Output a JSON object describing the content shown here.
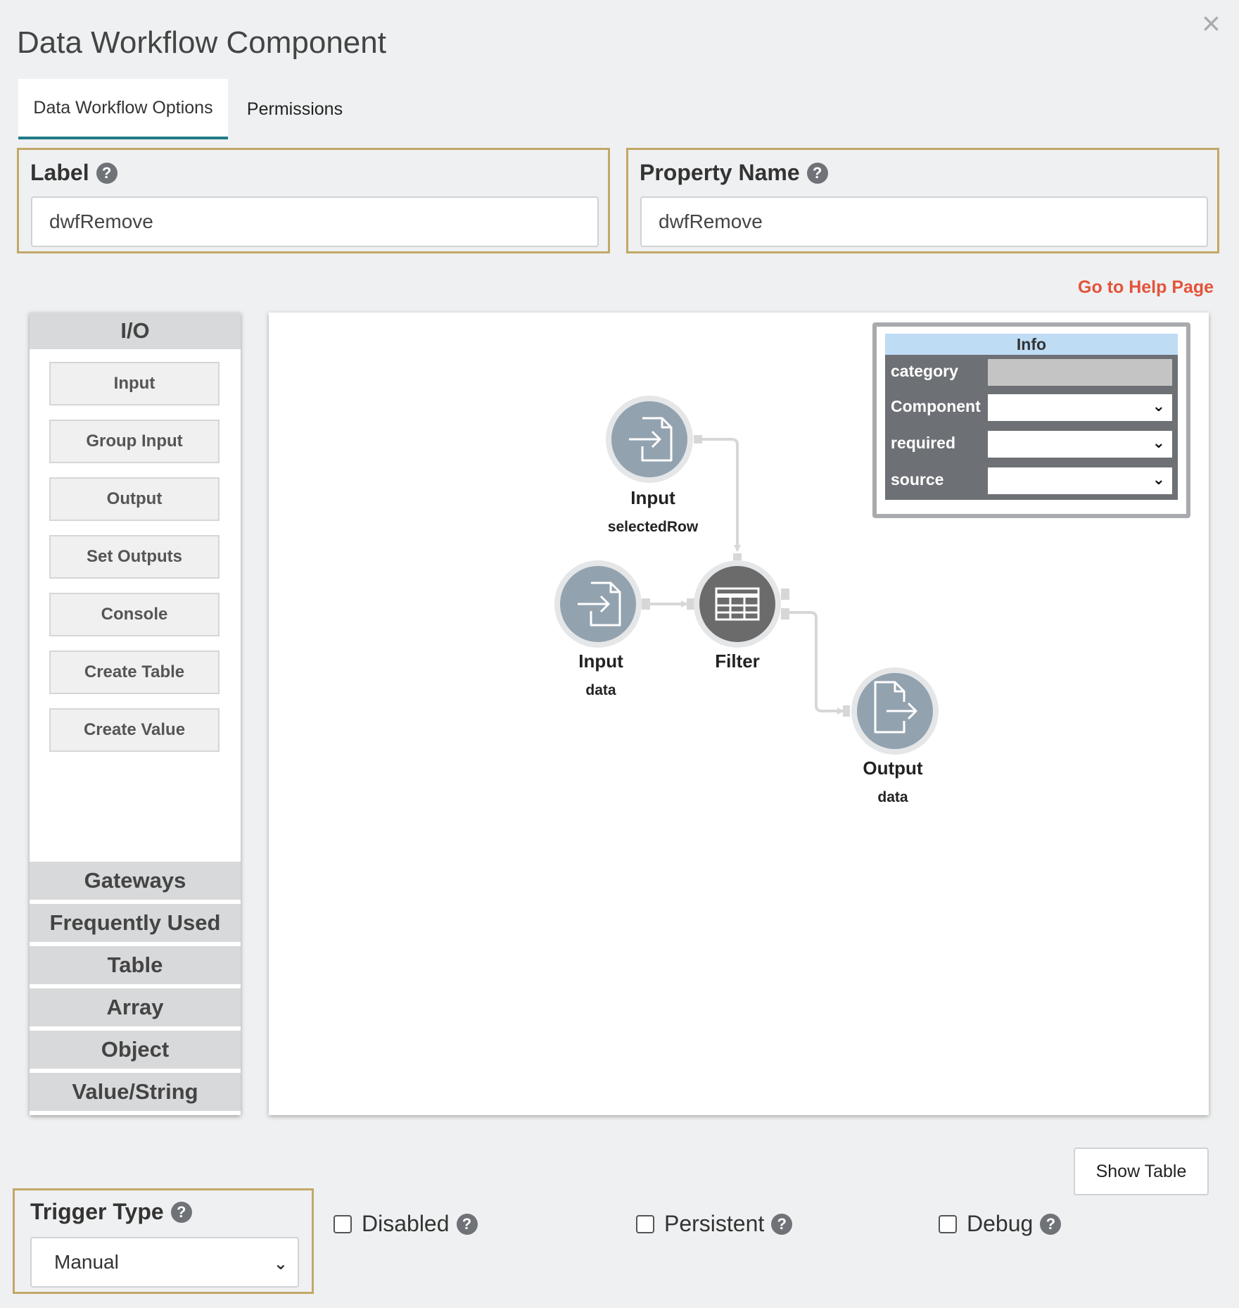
{
  "dialog": {
    "title": "Data Workflow Component",
    "close_glyph": "×"
  },
  "tabs": [
    {
      "label": "Data Workflow Options",
      "active": true
    },
    {
      "label": "Permissions",
      "active": false
    }
  ],
  "fields": {
    "label": {
      "label": "Label",
      "value": "dwfRemove"
    },
    "property_name": {
      "label": "Property Name",
      "value": "dwfRemove"
    }
  },
  "help_link": "Go to Help Page",
  "palette": {
    "header": "I/O",
    "items": [
      "Input",
      "Group Input",
      "Output",
      "Set Outputs",
      "Console",
      "Create Table",
      "Create Value"
    ],
    "sections": [
      "Gateways",
      "Frequently Used",
      "Table",
      "Array",
      "Object",
      "Value/String"
    ]
  },
  "workflow": {
    "nodes": [
      {
        "id": "input-selectedrow",
        "type": "Input",
        "name": "selectedRow",
        "icon": "file-import-icon"
      },
      {
        "id": "input-data",
        "type": "Input",
        "name": "data",
        "icon": "file-import-icon"
      },
      {
        "id": "filter",
        "type": "Filter",
        "name": "",
        "icon": "table-icon"
      },
      {
        "id": "output-data",
        "type": "Output",
        "name": "data",
        "icon": "file-export-icon"
      }
    ],
    "edges": [
      {
        "from": "input-selectedrow",
        "to": "filter"
      },
      {
        "from": "input-data",
        "to": "filter"
      },
      {
        "from": "filter",
        "to": "output-data"
      }
    ]
  },
  "info_panel": {
    "title": "Info",
    "rows": [
      {
        "key": "category",
        "value": "",
        "kind": "readonly"
      },
      {
        "key": "Component",
        "value": "",
        "kind": "select"
      },
      {
        "key": "required",
        "value": "",
        "kind": "select"
      },
      {
        "key": "source",
        "value": "",
        "kind": "select"
      }
    ]
  },
  "show_table_button": "Show Table",
  "trigger_type": {
    "label": "Trigger Type",
    "value": "Manual"
  },
  "checkboxes": [
    {
      "label": "Disabled",
      "checked": false
    },
    {
      "label": "Persistent",
      "checked": false
    },
    {
      "label": "Debug",
      "checked": false
    }
  ],
  "help_glyph": "?",
  "chevron_glyph": "⌄",
  "colors": {
    "accent_tab": "#1f7c88",
    "field_border": "#c2a868",
    "help_link": "#e4533a",
    "node_io": "#93a2af",
    "node_filter": "#6b6b6b",
    "info_header": "#bfdcf5"
  }
}
